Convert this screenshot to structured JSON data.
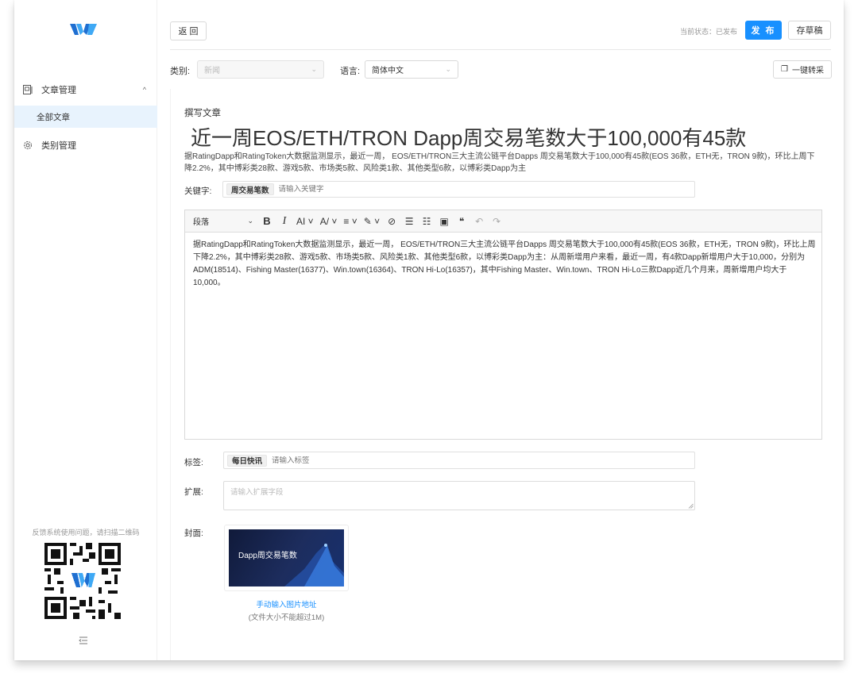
{
  "sidebar": {
    "menu_article": "文章管理",
    "menu_article_caret": "^",
    "submenu_all": "全部文章",
    "menu_category": "类别管理",
    "feedback_text": "反馈系统使用问题，请扫描二维码"
  },
  "topbar": {
    "back_label": "返 回",
    "status_text": "当前状态：已发布",
    "publish_label": "发 布",
    "draft_label": "存草稿"
  },
  "filters": {
    "category_label": "类别:",
    "category_value": "新闻",
    "language_label": "语言:",
    "language_value": "简体中文",
    "convert_label": "一键转采"
  },
  "article": {
    "write_label": "撰写文章",
    "title": "近一周EOS/ETH/TRON Dapp周交易笔数大于100,000有45款",
    "summary": "据RatingDapp和RatingToken大数据监测显示，最近一周， EOS/ETH/TRON三大主流公链平台Dapps 周交易笔数大于100,000有45款(EOS 36款，ETH无，TRON 9款)，环比上周下降2.2%，其中博彩类28款、游戏5款、市场类5款、风险类1款、其他类型6款，以博彩类Dapp为主",
    "keyword_label": "关键字:",
    "keyword_chip": "周交易笔数",
    "keyword_placeholder": "请输入关键字"
  },
  "editor": {
    "paragraph_select": "段落",
    "tools": [
      "B",
      "I",
      "AI ˅",
      "A/ ˅",
      "≡ ˅",
      "✎ ˅",
      "⊘",
      "☰",
      "☷",
      "▣",
      "❝",
      "↶",
      "↷"
    ],
    "body": "据RatingDapp和RatingToken大数据监测显示，最近一周， EOS/ETH/TRON三大主流公链平台Dapps 周交易笔数大于100,000有45款(EOS 36款，ETH无，TRON 9款)，环比上周下降2.2%，其中博彩类28款、游戏5款、市场类5款、风险类1款、其他类型6款，以博彩类Dapp为主：从周新增用户来看，最近一周，有4款Dapp新增用户大于10,000，分别为ADM(18514)、Fishing Master(16377)、Win.town(16364)、TRON Hi-Lo(16357)，其中Fishing Master、Win.town、TRON Hi-Lo三款Dapp近几个月来，周新增用户均大于10,000。"
  },
  "fields": {
    "tag_label": "标签:",
    "tag_chip": "每日快讯",
    "tag_placeholder": "请输入标签",
    "ext_label": "扩展:",
    "ext_placeholder": "请输入扩展字段",
    "cover_label": "封面:",
    "cover_image_text": "Dapp周交易笔数",
    "cover_link": "手动输入图片地址",
    "cover_note": "(文件大小不能超过1M)"
  },
  "colors": {
    "primary": "#1890ff",
    "active_menu_bg": "#e8f3fd",
    "logo_blue": "#2f8cf0"
  }
}
